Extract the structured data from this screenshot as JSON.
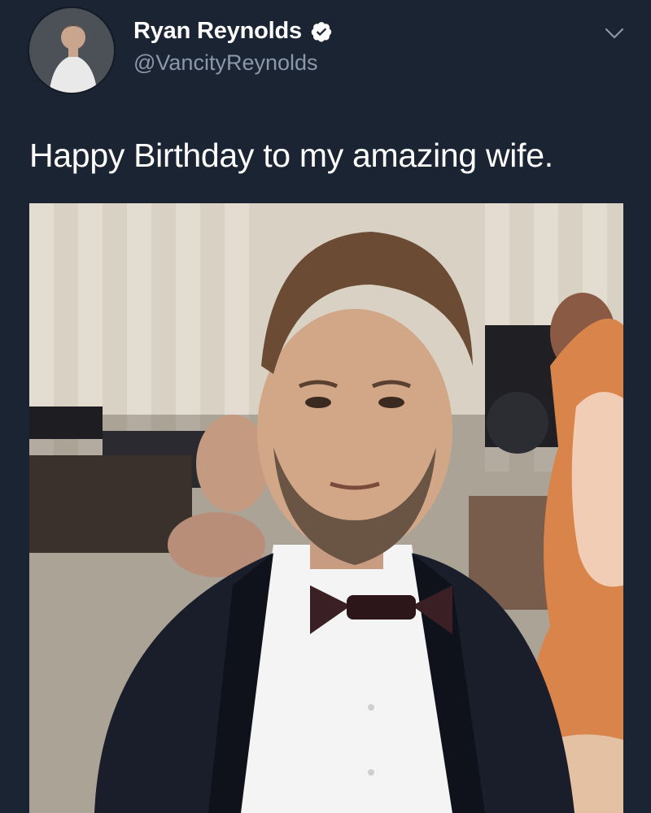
{
  "tweet": {
    "author": {
      "display_name": "Ryan Reynolds",
      "handle": "@VancityReynolds",
      "verified": true,
      "avatar_icon": "user-avatar"
    },
    "text": "Happy Birthday to my amazing wife.",
    "menu_icon": "chevron-down-icon",
    "media": {
      "kind": "photo",
      "description_icon": "photo-icon"
    }
  },
  "colors": {
    "background": "#1b2432",
    "primary_text": "#ffffff",
    "secondary_text": "#8b98a7",
    "verified_badge": "#ffffff"
  }
}
